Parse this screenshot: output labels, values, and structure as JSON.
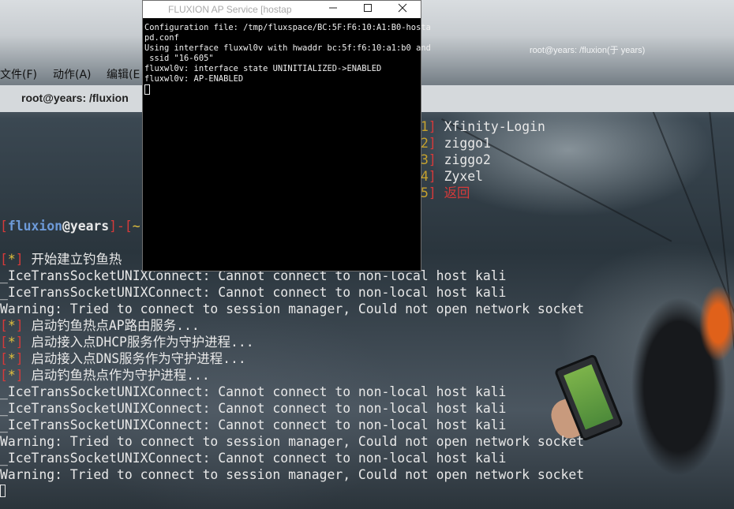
{
  "background_window": {
    "title": "root@years: /fluxion(于 years)",
    "menu": [
      "文件(F)",
      "动作(A)",
      "编辑(E"
    ],
    "tab_title": "root@years: /fluxion"
  },
  "xterm": {
    "title": "FLUXION AP Service [hostap",
    "lines": [
      "Configuration file: /tmp/fluxspace/BC:5F:F6:10:A1:B0-hosta",
      "pd.conf",
      "Using interface fluxwl0v with hwaddr bc:5f:f6:10:a1:b0 and",
      " ssid \"16-605\"",
      "fluxwl0v: interface state UNINITIALIZED->ENABLED",
      "fluxwl0v: AP-ENABLED"
    ]
  },
  "menu_options": [
    {
      "num": "1",
      "label": "Xfinity-Login"
    },
    {
      "num": "2",
      "label": "ziggo1"
    },
    {
      "num": "3",
      "label": "ziggo2"
    },
    {
      "num": "4",
      "label": "Zyxel"
    },
    {
      "num": "5",
      "label": "返回"
    }
  ],
  "prompt": {
    "user": "fluxion",
    "at": "@",
    "host": "years",
    "sep": "]-[",
    "dir": "~"
  },
  "terminal_lines": [
    {
      "type": "info",
      "text": "开始建立钓鱼热"
    },
    {
      "type": "plain",
      "text": "_IceTransSocketUNIXConnect: Cannot connect to non-local host kali"
    },
    {
      "type": "plain",
      "text": "_IceTransSocketUNIXConnect: Cannot connect to non-local host kali"
    },
    {
      "type": "plain",
      "text": "Warning: Tried to connect to session manager, Could not open network socket"
    },
    {
      "type": "info",
      "text": "启动钓鱼热点AP路由服务..."
    },
    {
      "type": "info",
      "text": "启动接入点DHCP服务作为守护进程..."
    },
    {
      "type": "info",
      "text": "启动接入点DNS服务作为守护进程..."
    },
    {
      "type": "info",
      "text": "启动钓鱼热点作为守护进程..."
    },
    {
      "type": "plain",
      "text": "_IceTransSocketUNIXConnect: Cannot connect to non-local host kali"
    },
    {
      "type": "plain",
      "text": "_IceTransSocketUNIXConnect: Cannot connect to non-local host kali"
    },
    {
      "type": "plain",
      "text": "_IceTransSocketUNIXConnect: Cannot connect to non-local host kali"
    },
    {
      "type": "plain",
      "text": "Warning: Tried to connect to session manager, Could not open network socket"
    },
    {
      "type": "plain",
      "text": "_IceTransSocketUNIXConnect: Cannot connect to non-local host kali"
    },
    {
      "type": "plain",
      "text": "Warning: Tried to connect to session manager, Could not open network socket"
    }
  ],
  "info_marker": "*",
  "colors": {
    "terminal_bg": "#2a353d",
    "bracket_red": "#d63a3a",
    "marker_yellow": "#e2c13d",
    "prompt_blue": "#6d9ad8",
    "option_number": "#c7a22d"
  }
}
